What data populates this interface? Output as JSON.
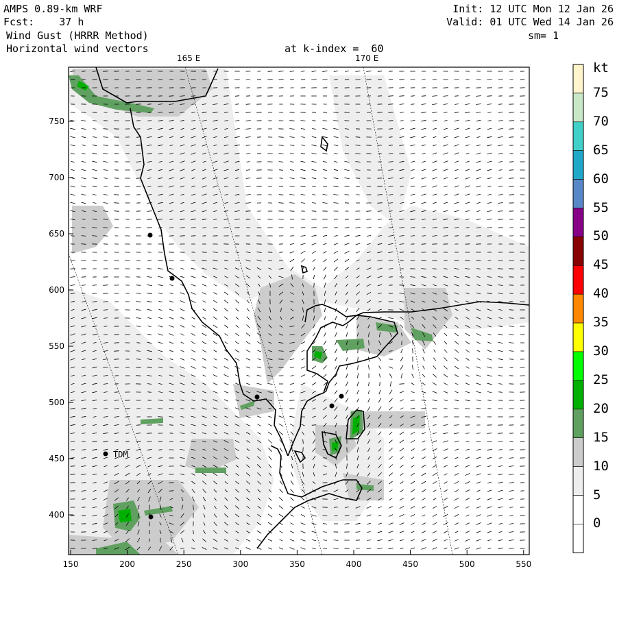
{
  "header": {
    "model": "AMPS 0.89-km WRF",
    "fcst": "Fcst:    37 h",
    "field": "Wind Gust (HRRR Method)",
    "vectors": "Horizontal wind vectors",
    "init": "Init: 12 UTC Mon 12 Jan 26",
    "valid": "Valid: 01 UTC Wed 14 Jan 26",
    "smoothing": "sm= 1",
    "kindex": "at k-index =  60"
  },
  "map": {
    "x_ticks": [
      "150",
      "200",
      "250",
      "300",
      "350",
      "400",
      "450",
      "500",
      "550"
    ],
    "y_ticks": [
      "750",
      "700",
      "650",
      "600",
      "550",
      "500",
      "450",
      "400"
    ],
    "lon_labels": [
      "165 E",
      "170 E"
    ],
    "station_label": "TDM"
  },
  "colorbar": {
    "unit": "kt",
    "labels": [
      "75",
      "70",
      "65",
      "60",
      "55",
      "50",
      "45",
      "40",
      "35",
      "30",
      "25",
      "20",
      "15",
      "10",
      "5",
      "0"
    ],
    "colors": [
      "#fff4cc",
      "#c8e8c8",
      "#40d0c8",
      "#20a8c8",
      "#5888c8",
      "#880088",
      "#880000",
      "#ff0000",
      "#ff8800",
      "#ffff00",
      "#00ff00",
      "#00b000",
      "#60a060",
      "#cccccc",
      "#eeeeee",
      "#ffffff",
      "#ffffff"
    ]
  }
}
